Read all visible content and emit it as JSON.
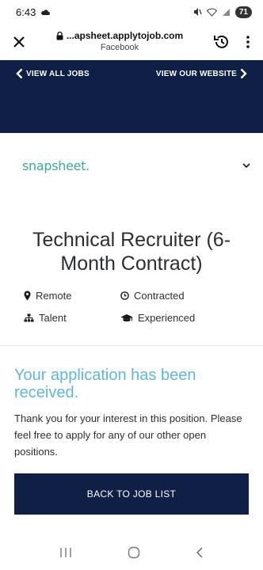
{
  "status_bar": {
    "time": "6:43",
    "battery": "71"
  },
  "browser": {
    "url": "...apsheet.applytojob.com",
    "subtitle": "Facebook"
  },
  "header_nav": {
    "left_label": "VIEW ALL JOBS",
    "right_label": "VIEW OUR WEBSITE"
  },
  "logo": {
    "text": "snapsheet."
  },
  "job": {
    "title": "Technical Recruiter (6-Month Contract)",
    "location": "Remote",
    "type": "Contracted",
    "department": "Talent",
    "level": "Experienced"
  },
  "confirmation": {
    "heading": "Your application has been received.",
    "message": "Thank you for your interest in this position. Please feel free to apply for any of our other open positions."
  },
  "back_button": {
    "label": "BACK TO JOB LIST"
  },
  "colors": {
    "navy": "#0f1f45",
    "accent_blue": "#5db8df",
    "logo_teal": "#3aa9a0"
  }
}
